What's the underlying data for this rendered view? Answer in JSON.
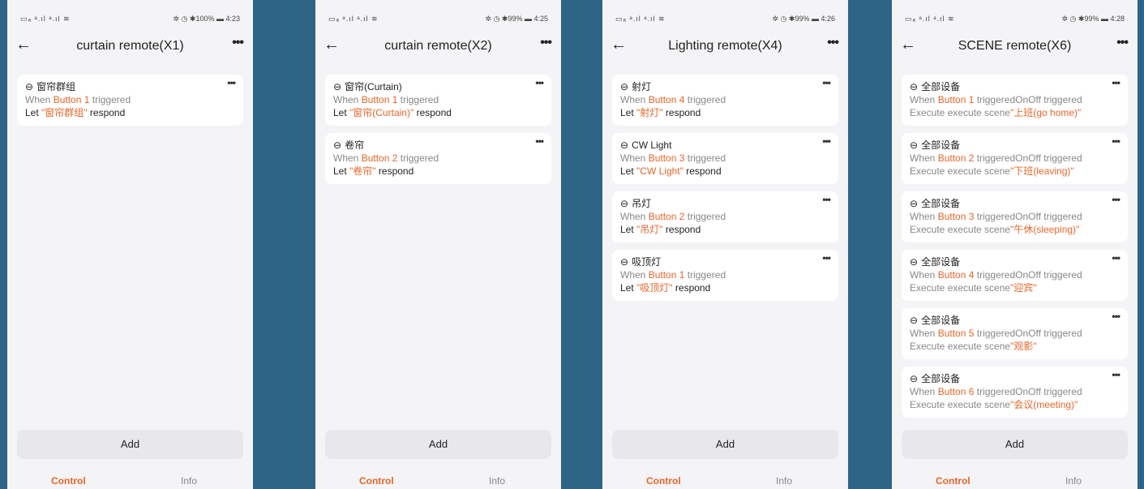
{
  "phones": [
    {
      "status": {
        "left": "▭ₐ ᵃ.ıl ᵃ.ıl ≋",
        "right": "✲ ◷ ✱100% ▬ 4:23"
      },
      "title": "curtain remote(X1)",
      "back_icon": "←",
      "more_icon": "•••",
      "cards": [
        {
          "name": "窗帘群组",
          "when": "When",
          "button": "Button 1",
          "triggered": "triggered",
          "let": "Let",
          "target": "\"窗帘群组\"",
          "respond": "respond"
        }
      ],
      "add_label": "Add",
      "tab_control": "Control",
      "tab_info": "Info"
    },
    {
      "status": {
        "left": "▭ₐ ᵃ.ıl ᵃ.ıl ≋",
        "right": "✲ ◷ ✱99% ▬ 4:25"
      },
      "title": "curtain remote(X2)",
      "back_icon": "←",
      "more_icon": "•••",
      "cards": [
        {
          "name": "窗帘(Curtain)",
          "when": "When",
          "button": "Button 1",
          "triggered": "triggered",
          "let": "Let",
          "target": "\"窗帘(Curtain)\"",
          "respond": "respond"
        },
        {
          "name": "卷帘",
          "when": "When",
          "button": "Button 2",
          "triggered": "triggered",
          "let": "Let",
          "target": "\"卷帘\"",
          "respond": "respond"
        }
      ],
      "add_label": "Add",
      "tab_control": "Control",
      "tab_info": "Info"
    },
    {
      "status": {
        "left": "▭ₐ ᵃ.ıl ᵃ.ıl ≋",
        "right": "✲ ◷ ✱99% ▬ 4:26"
      },
      "title": "Lighting remote(X4)",
      "back_icon": "←",
      "more_icon": "•••",
      "cards": [
        {
          "name": "射灯",
          "when": "When",
          "button": "Button 4",
          "triggered": "triggered",
          "let": "Let",
          "target": "\"射灯\"",
          "respond": "respond"
        },
        {
          "name": "CW Light",
          "when": "When",
          "button": "Button 3",
          "triggered": "triggered",
          "let": "Let",
          "target": "\"CW Light\"",
          "respond": "respond"
        },
        {
          "name": "吊灯",
          "when": "When",
          "button": "Button 2",
          "triggered": "triggered",
          "let": "Let",
          "target": "\"吊灯\"",
          "respond": "respond"
        },
        {
          "name": "吸顶灯",
          "when": "When",
          "button": "Button 1",
          "triggered": "triggered",
          "let": "Let",
          "target": "\"吸顶灯\"",
          "respond": "respond"
        }
      ],
      "add_label": "Add",
      "tab_control": "Control",
      "tab_info": "Info"
    },
    {
      "status": {
        "left": "▭ₐ ᵃ.ıl ᵃ.ıl ≋",
        "right": "✲ ◷ ✱99% ▬ 4:28"
      },
      "title": "SCENE remote(X6)",
      "back_icon": "←",
      "more_icon": "•••",
      "scene_cards": [
        {
          "name": "全部设备",
          "when": "When",
          "button": "Button 1",
          "triggered": "triggered",
          "onoff": "OnOff triggered",
          "execute": "Execute execute scene",
          "scene": "\"上班(go home)\""
        },
        {
          "name": "全部设备",
          "when": "When",
          "button": "Button 2",
          "triggered": "triggered",
          "onoff": "OnOff triggered",
          "execute": "Execute execute scene",
          "scene": "\"下班(leaving)\""
        },
        {
          "name": "全部设备",
          "when": "When",
          "button": "Button 3",
          "triggered": "triggered",
          "onoff": "OnOff triggered",
          "execute": "Execute execute scene",
          "scene": "\"午休(sleeping)\""
        },
        {
          "name": "全部设备",
          "when": "When",
          "button": "Button 4",
          "triggered": "triggered",
          "onoff": "OnOff triggered",
          "execute": "Execute execute scene",
          "scene": "\"迎宾\""
        },
        {
          "name": "全部设备",
          "when": "When",
          "button": "Button 5",
          "triggered": "triggered",
          "onoff": "OnOff triggered",
          "execute": "Execute execute scene",
          "scene": "\"观影\""
        },
        {
          "name": "全部设备",
          "when": "When",
          "button": "Button 6",
          "triggered": "triggered",
          "onoff": "OnOff triggered",
          "execute": "Execute execute scene",
          "scene": "\"会议(meeting)\""
        }
      ],
      "add_label": "Add",
      "tab_control": "Control",
      "tab_info": "Info"
    }
  ],
  "colors": {
    "background": "#2e6486",
    "accent": "#e8662a",
    "panel": "#f4f4f6"
  },
  "icons": {
    "link": "link-icon",
    "back": "back-arrow-icon",
    "more": "more-icon"
  }
}
